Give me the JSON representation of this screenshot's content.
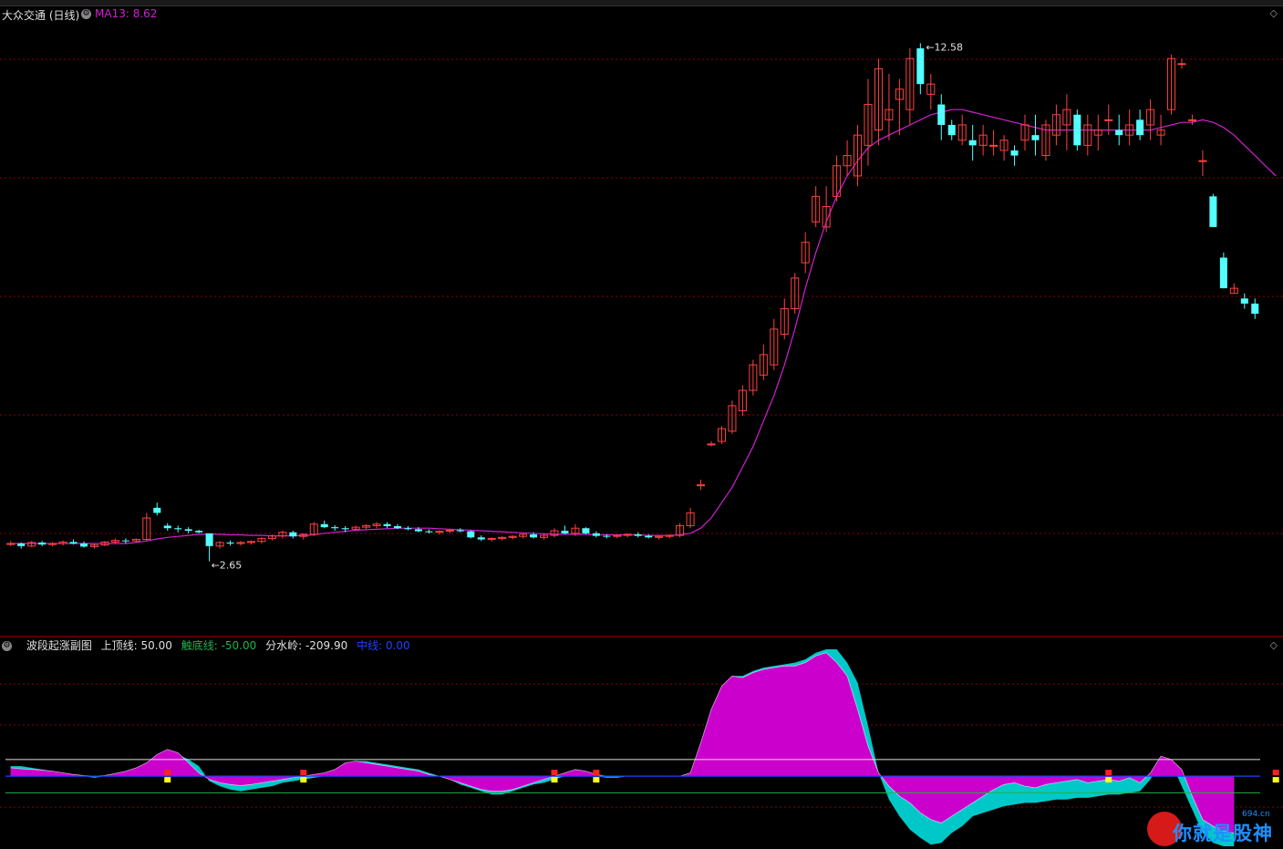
{
  "header": {
    "stock_name": "大众交通 (日线)",
    "ma_label": "MA13: 8.62"
  },
  "sub_header": {
    "title": "波段起涨副图",
    "upper_line": "上顶线: 50.00",
    "lower_line": "触底线: -50.00",
    "divide_line": "分水岭: -209.90",
    "mid_line": "中线: 0.00"
  },
  "watermark": {
    "text": "你就是股神",
    "small": "694.cn"
  },
  "colors": {
    "up": "#ff4040",
    "down": "#54ffff",
    "ma": "#d020d0",
    "magenta_area": "#cc00cc",
    "cyan_area": "#00c8c8",
    "grid": "#8b0000"
  },
  "chart_data": [
    {
      "type": "candlestick",
      "title": "大众交通 (日线)",
      "ylim": [
        1.5,
        13.2
      ],
      "max_label": "12.58",
      "min_label": "2.65",
      "candles": [
        [
          3.0,
          3.05,
          2.95,
          3.0
        ],
        [
          3.0,
          3.02,
          2.9,
          2.95
        ],
        [
          2.95,
          3.05,
          2.93,
          3.02
        ],
        [
          3.02,
          3.05,
          2.95,
          2.98
        ],
        [
          2.98,
          3.03,
          2.94,
          3.0
        ],
        [
          3.0,
          3.06,
          2.96,
          3.03
        ],
        [
          3.03,
          3.08,
          2.98,
          3.0
        ],
        [
          3.0,
          3.04,
          2.92,
          2.94
        ],
        [
          2.94,
          3.0,
          2.9,
          2.97
        ],
        [
          2.97,
          3.05,
          2.95,
          3.03
        ],
        [
          3.03,
          3.1,
          3.0,
          3.06
        ],
        [
          3.06,
          3.1,
          3.0,
          3.05
        ],
        [
          3.05,
          3.1,
          3.02,
          3.08
        ],
        [
          3.08,
          3.6,
          3.05,
          3.5
        ],
        [
          3.7,
          3.8,
          3.55,
          3.6
        ],
        [
          3.35,
          3.4,
          3.25,
          3.3
        ],
        [
          3.3,
          3.35,
          3.22,
          3.28
        ],
        [
          3.28,
          3.32,
          3.2,
          3.25
        ],
        [
          3.25,
          3.27,
          3.2,
          3.22
        ],
        [
          3.2,
          3.2,
          2.65,
          2.95
        ],
        [
          2.95,
          3.05,
          2.9,
          3.02
        ],
        [
          3.02,
          3.06,
          2.96,
          3.0
        ],
        [
          3.0,
          3.05,
          2.96,
          3.02
        ],
        [
          3.02,
          3.06,
          2.98,
          3.04
        ],
        [
          3.04,
          3.12,
          3.0,
          3.1
        ],
        [
          3.1,
          3.18,
          3.06,
          3.15
        ],
        [
          3.15,
          3.25,
          3.1,
          3.22
        ],
        [
          3.22,
          3.25,
          3.1,
          3.14
        ],
        [
          3.14,
          3.2,
          3.08,
          3.18
        ],
        [
          3.18,
          3.42,
          3.15,
          3.38
        ],
        [
          3.38,
          3.45,
          3.3,
          3.32
        ],
        [
          3.32,
          3.36,
          3.25,
          3.3
        ],
        [
          3.3,
          3.34,
          3.22,
          3.28
        ],
        [
          3.28,
          3.35,
          3.25,
          3.32
        ],
        [
          3.32,
          3.38,
          3.28,
          3.35
        ],
        [
          3.35,
          3.42,
          3.3,
          3.38
        ],
        [
          3.38,
          3.42,
          3.3,
          3.34
        ],
        [
          3.34,
          3.38,
          3.28,
          3.3
        ],
        [
          3.3,
          3.34,
          3.26,
          3.28
        ],
        [
          3.28,
          3.32,
          3.22,
          3.24
        ],
        [
          3.24,
          3.28,
          3.2,
          3.22
        ],
        [
          3.22,
          3.26,
          3.18,
          3.24
        ],
        [
          3.24,
          3.28,
          3.2,
          3.26
        ],
        [
          3.26,
          3.3,
          3.22,
          3.24
        ],
        [
          3.24,
          3.26,
          3.1,
          3.12
        ],
        [
          3.12,
          3.16,
          3.05,
          3.08
        ],
        [
          3.08,
          3.12,
          3.04,
          3.1
        ],
        [
          3.1,
          3.14,
          3.06,
          3.12
        ],
        [
          3.12,
          3.16,
          3.08,
          3.14
        ],
        [
          3.14,
          3.2,
          3.1,
          3.18
        ],
        [
          3.18,
          3.22,
          3.1,
          3.12
        ],
        [
          3.12,
          3.18,
          3.08,
          3.16
        ],
        [
          3.16,
          3.3,
          3.12,
          3.25
        ],
        [
          3.25,
          3.35,
          3.18,
          3.2
        ],
        [
          3.2,
          3.38,
          3.15,
          3.3
        ],
        [
          3.3,
          3.32,
          3.18,
          3.2
        ],
        [
          3.2,
          3.24,
          3.12,
          3.15
        ],
        [
          3.15,
          3.18,
          3.1,
          3.14
        ],
        [
          3.14,
          3.18,
          3.1,
          3.16
        ],
        [
          3.16,
          3.2,
          3.12,
          3.18
        ],
        [
          3.18,
          3.22,
          3.12,
          3.15
        ],
        [
          3.15,
          3.18,
          3.1,
          3.12
        ],
        [
          3.12,
          3.16,
          3.08,
          3.14
        ],
        [
          3.14,
          3.18,
          3.1,
          3.16
        ],
        [
          3.16,
          3.4,
          3.12,
          3.35
        ],
        [
          3.35,
          3.7,
          3.3,
          3.6
        ],
        [
          4.15,
          4.25,
          4.05,
          4.15
        ],
        [
          4.95,
          5.0,
          4.9,
          4.95
        ],
        [
          5.0,
          5.3,
          4.95,
          5.25
        ],
        [
          5.2,
          5.8,
          5.15,
          5.7
        ],
        [
          5.6,
          6.1,
          5.5,
          6.0
        ],
        [
          6.0,
          6.6,
          5.9,
          6.5
        ],
        [
          6.3,
          6.9,
          6.2,
          6.7
        ],
        [
          6.5,
          7.4,
          6.4,
          7.2
        ],
        [
          7.1,
          7.8,
          7.0,
          7.6
        ],
        [
          7.6,
          8.3,
          7.5,
          8.2
        ],
        [
          8.5,
          9.1,
          8.3,
          8.9
        ],
        [
          9.3,
          10.0,
          9.2,
          9.8
        ],
        [
          9.2,
          10.0,
          9.1,
          9.6
        ],
        [
          9.8,
          10.6,
          9.7,
          10.4
        ],
        [
          10.4,
          10.9,
          10.2,
          10.6
        ],
        [
          10.2,
          11.2,
          10.0,
          11.0
        ],
        [
          10.8,
          12.1,
          10.4,
          11.6
        ],
        [
          11.1,
          12.5,
          10.8,
          12.3
        ],
        [
          11.3,
          12.2,
          10.9,
          11.5
        ],
        [
          11.7,
          12.1,
          11.0,
          11.9
        ],
        [
          11.5,
          12.7,
          11.2,
          12.5
        ],
        [
          12.7,
          12.8,
          11.8,
          12.0
        ],
        [
          11.8,
          12.2,
          11.5,
          12.0
        ],
        [
          11.6,
          11.8,
          10.9,
          11.2
        ],
        [
          11.2,
          11.3,
          10.9,
          11.0
        ],
        [
          10.9,
          11.4,
          10.8,
          11.2
        ],
        [
          10.9,
          11.2,
          10.5,
          10.8
        ],
        [
          10.8,
          11.2,
          10.6,
          11.0
        ],
        [
          10.8,
          11.1,
          10.6,
          10.8
        ],
        [
          10.7,
          11.0,
          10.5,
          10.9
        ],
        [
          10.7,
          10.8,
          10.4,
          10.6
        ],
        [
          10.9,
          11.4,
          10.7,
          11.2
        ],
        [
          11.0,
          11.4,
          10.6,
          10.9
        ],
        [
          10.6,
          11.3,
          10.5,
          11.2
        ],
        [
          11.0,
          11.6,
          10.8,
          11.4
        ],
        [
          11.2,
          11.8,
          10.7,
          11.5
        ],
        [
          11.4,
          11.5,
          10.7,
          10.8
        ],
        [
          10.8,
          11.4,
          10.6,
          11.2
        ],
        [
          11.0,
          11.4,
          10.7,
          11.1
        ],
        [
          11.3,
          11.6,
          11.0,
          11.3
        ],
        [
          11.1,
          11.4,
          10.8,
          11.0
        ],
        [
          11.0,
          11.5,
          10.8,
          11.2
        ],
        [
          11.3,
          11.5,
          10.9,
          11.0
        ],
        [
          11.2,
          11.7,
          10.9,
          11.5
        ],
        [
          11.0,
          11.4,
          10.8,
          11.1
        ],
        [
          11.5,
          12.58,
          11.4,
          12.5
        ],
        [
          12.4,
          12.5,
          12.3,
          12.4
        ],
        [
          11.3,
          11.4,
          11.2,
          11.3
        ],
        [
          10.5,
          10.7,
          10.2,
          10.5
        ],
        [
          9.8,
          9.85,
          9.2,
          9.2
        ],
        [
          8.6,
          8.7,
          8.0,
          8.0
        ],
        [
          7.9,
          8.1,
          7.9,
          8.0
        ],
        [
          7.8,
          7.9,
          7.6,
          7.7
        ],
        [
          7.7,
          7.8,
          7.4,
          7.5
        ]
      ],
      "ma13": [
        3.0,
        3.0,
        3.0,
        3.0,
        3.0,
        3.0,
        3.0,
        3.0,
        3.0,
        3.0,
        3.0,
        3.0,
        3.02,
        3.05,
        3.09,
        3.12,
        3.14,
        3.16,
        3.18,
        3.18,
        3.18,
        3.17,
        3.17,
        3.16,
        3.16,
        3.15,
        3.15,
        3.15,
        3.16,
        3.17,
        3.2,
        3.22,
        3.24,
        3.26,
        3.27,
        3.28,
        3.29,
        3.3,
        3.3,
        3.3,
        3.3,
        3.29,
        3.28,
        3.27,
        3.26,
        3.25,
        3.24,
        3.23,
        3.22,
        3.21,
        3.2,
        3.19,
        3.18,
        3.18,
        3.18,
        3.18,
        3.17,
        3.17,
        3.17,
        3.17,
        3.17,
        3.16,
        3.16,
        3.16,
        3.17,
        3.2,
        3.3,
        3.5,
        3.8,
        4.1,
        4.5,
        4.9,
        5.4,
        5.9,
        6.5,
        7.2,
        8.0,
        8.7,
        9.3,
        9.8,
        10.2,
        10.5,
        10.75,
        10.9,
        11.0,
        11.1,
        11.2,
        11.3,
        11.4,
        11.45,
        11.5,
        11.5,
        11.45,
        11.4,
        11.35,
        11.3,
        11.25,
        11.2,
        11.15,
        11.1,
        11.1,
        11.1,
        11.1,
        11.1,
        11.1,
        11.1,
        11.1,
        11.1,
        11.1,
        11.1,
        11.15,
        11.2,
        11.25,
        11.25,
        11.3,
        11.25,
        11.15,
        11.0,
        10.8,
        10.6,
        10.4,
        10.2
      ]
    },
    {
      "type": "area",
      "title": "波段起涨副图",
      "ylim": [
        -210,
        380
      ],
      "reference_lines": {
        "上顶线": 50,
        "触底线": -50,
        "中线": 0
      },
      "series": [
        {
          "name": "magenta",
          "values": [
            25,
            22,
            20,
            18,
            15,
            10,
            5,
            2,
            0,
            2,
            8,
            15,
            25,
            40,
            65,
            80,
            70,
            40,
            10,
            -10,
            -20,
            -25,
            -28,
            -25,
            -20,
            -15,
            -10,
            -5,
            0,
            5,
            10,
            20,
            40,
            45,
            40,
            35,
            30,
            25,
            20,
            15,
            5,
            0,
            -10,
            -20,
            -30,
            -40,
            -45,
            -45,
            -40,
            -30,
            -20,
            -10,
            0,
            10,
            20,
            15,
            5,
            0,
            0,
            0,
            0,
            0,
            0,
            0,
            0,
            10,
            100,
            200,
            270,
            300,
            295,
            310,
            320,
            325,
            330,
            330,
            340,
            360,
            370,
            340,
            300,
            200,
            90,
            10,
            -30,
            -60,
            -80,
            -110,
            -130,
            -140,
            -120,
            -100,
            -80,
            -60,
            -40,
            -25,
            -20,
            -30,
            -35,
            -25,
            -20,
            -15,
            -10,
            -20,
            -15,
            -10,
            -15,
            -5,
            -20,
            10,
            60,
            50,
            20,
            -60,
            -130,
            -150,
            -165,
            -170
          ]
        },
        {
          "name": "cyan",
          "values": [
            30,
            30,
            25,
            20,
            15,
            10,
            5,
            0,
            -5,
            0,
            5,
            10,
            20,
            35,
            55,
            75,
            65,
            50,
            30,
            -15,
            -30,
            -40,
            -45,
            -40,
            -35,
            -30,
            -20,
            -15,
            -10,
            -5,
            0,
            10,
            35,
            45,
            45,
            40,
            35,
            30,
            25,
            20,
            10,
            0,
            -10,
            -25,
            -35,
            -45,
            -55,
            -55,
            -45,
            -35,
            -25,
            -20,
            -10,
            0,
            10,
            10,
            0,
            -5,
            -5,
            0,
            0,
            0,
            0,
            0,
            0,
            10,
            100,
            200,
            270,
            300,
            300,
            315,
            325,
            330,
            335,
            340,
            350,
            370,
            380,
            380,
            340,
            280,
            150,
            10,
            -70,
            -120,
            -160,
            -185,
            -205,
            -200,
            -170,
            -150,
            -120,
            -110,
            -100,
            -90,
            -85,
            -80,
            -80,
            -75,
            -70,
            -70,
            -65,
            -65,
            -60,
            -55,
            -55,
            -50,
            -45,
            -10,
            50,
            40,
            -30,
            -100,
            -170,
            -200,
            -210,
            -210
          ]
        }
      ],
      "buy_markers": [
        15,
        28,
        52,
        56,
        105,
        121
      ]
    }
  ]
}
